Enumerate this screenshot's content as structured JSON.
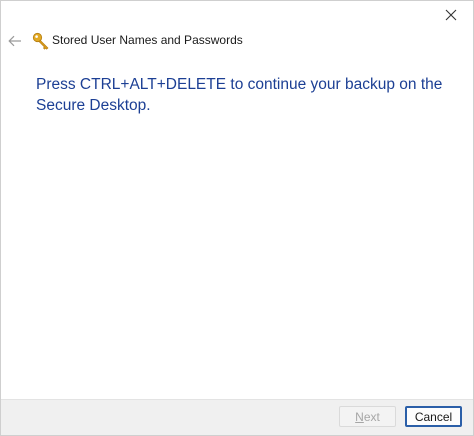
{
  "window": {
    "close_icon": "close-icon"
  },
  "header": {
    "back_icon": "back-arrow-icon",
    "app_icon": "key-icon",
    "title": "Stored User Names and Passwords"
  },
  "main": {
    "message": "Press CTRL+ALT+DELETE to continue your backup on the Secure Desktop."
  },
  "footer": {
    "next_label_accel": "N",
    "next_label_rest": "ext",
    "next_enabled": false,
    "cancel_label": "Cancel"
  },
  "colors": {
    "message_text": "#1c3f94",
    "cancel_border": "#2b5fa8",
    "disabled_text": "#a6a6a6"
  }
}
